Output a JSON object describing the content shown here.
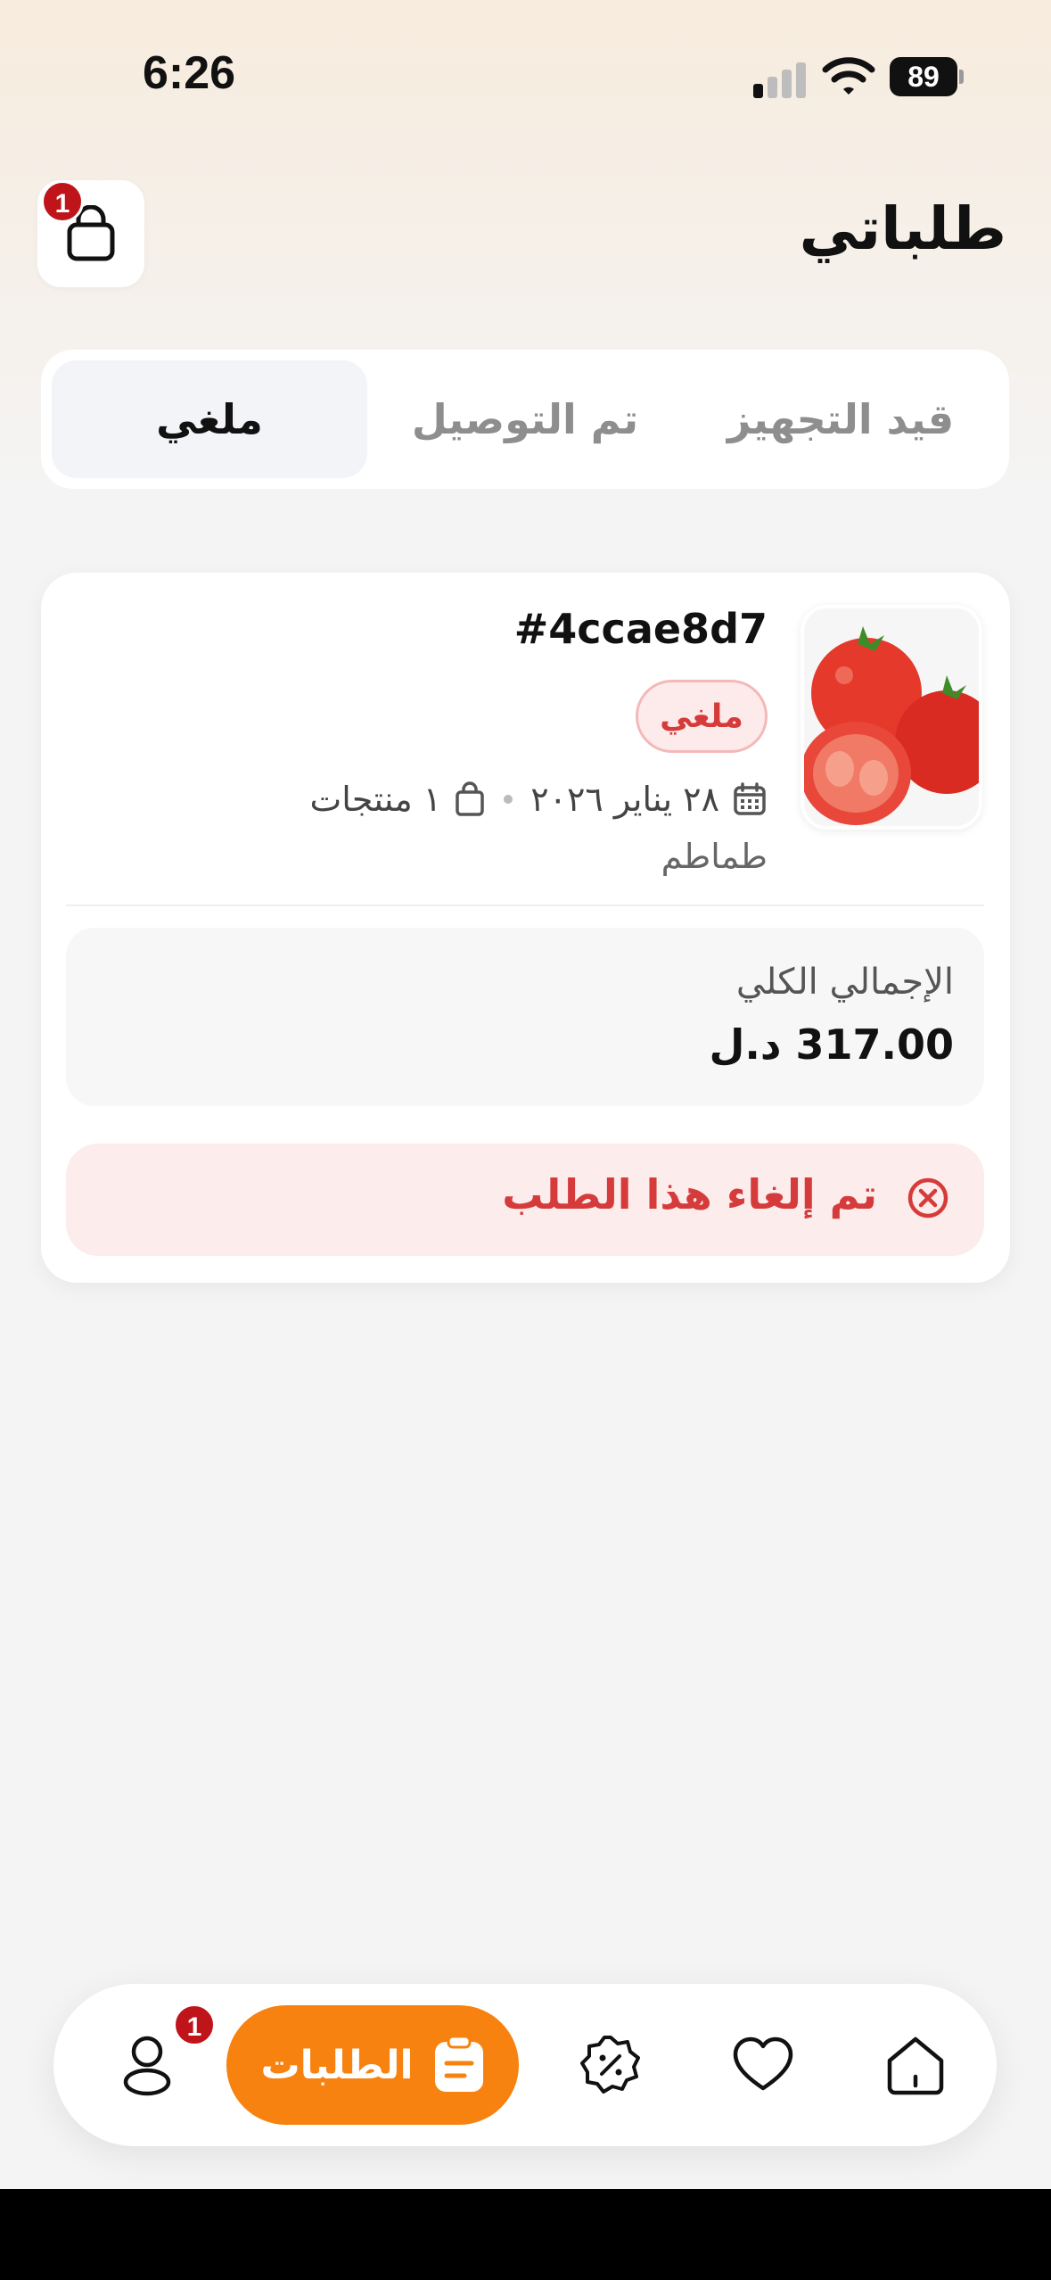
{
  "status_bar": {
    "time": "6:26",
    "battery": "89",
    "signal_bars_on": 1,
    "signal_bars_total": 4
  },
  "header": {
    "title": "طلباتي",
    "cart_badge": "1",
    "cart_icon": "shopping-bag-icon"
  },
  "tabs": [
    {
      "label": "قيد التجهيز",
      "active": false
    },
    {
      "label": "تم التوصيل",
      "active": false
    },
    {
      "label": "ملغي",
      "active": true
    }
  ],
  "order": {
    "id": "#4ccae8d7",
    "status": "ملغي",
    "date": "٢٨ يناير ٢٠٢٦",
    "items_count": "١ منتجات",
    "products": "طماطم",
    "total_label": "الإجمالي الكلي",
    "total_value": "317.00 د.ل",
    "cancel_message": "تم إلغاء هذا الطلب"
  },
  "bottom_nav": {
    "items": [
      {
        "name": "home",
        "icon": "home-icon"
      },
      {
        "name": "favorites",
        "icon": "heart-icon"
      },
      {
        "name": "offers",
        "icon": "discount-badge-icon"
      },
      {
        "name": "orders",
        "icon": "clipboard-icon",
        "label": "الطلبات",
        "active": true,
        "badge": "1"
      },
      {
        "name": "profile",
        "icon": "user-icon"
      }
    ],
    "active_color": "#f7820f"
  },
  "colors": {
    "accent": "#f7820f",
    "cancel_red": "#d63b3b",
    "badge_red": "#c0141b"
  }
}
